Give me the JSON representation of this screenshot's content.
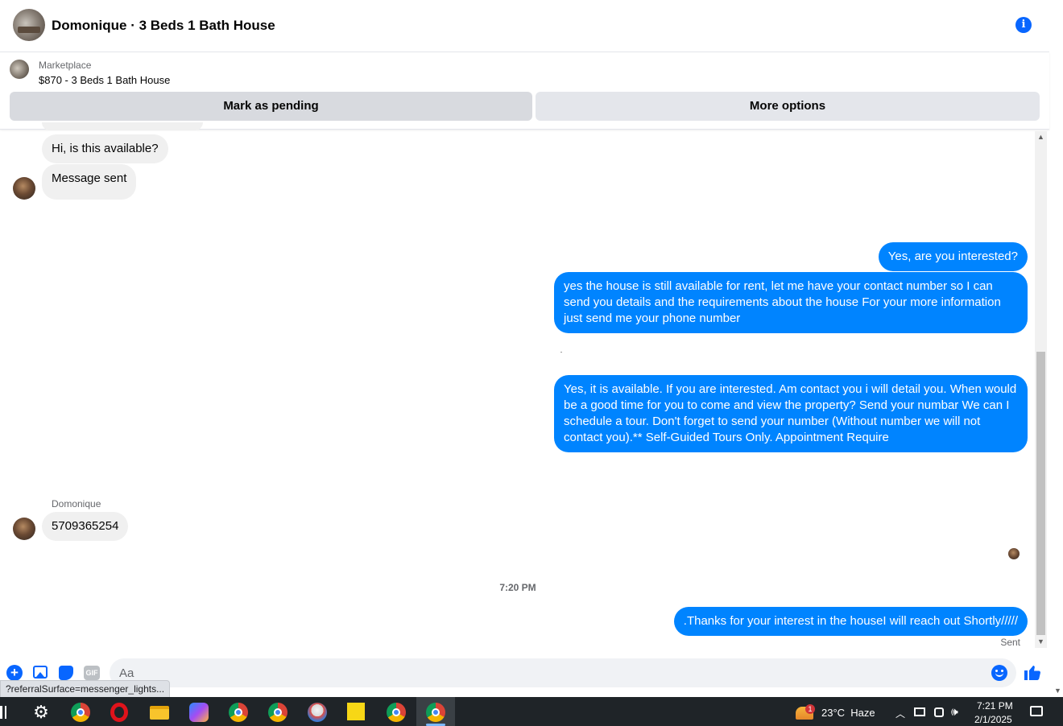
{
  "header": {
    "title": "Domonique · 3 Beds 1 Bath House"
  },
  "listing": {
    "source_label": "Marketplace",
    "item_text": "$870 - 3 Beds 1 Bath House",
    "pending_button": "Mark as pending",
    "more_button": "More options"
  },
  "messages": {
    "in_1": "Hi, is this available?",
    "in_2": "Message sent",
    "out_1": "Yes, are you interested?",
    "out_2": "yes the house is still available for rent, let me have your contact number so I can send you details and the requirements about the house For  your  more  information  just send  me   your  phone  number",
    "out_3": "Yes, it is available. If you are interested.  Am contact you i will detail you.  When would be a good time for you to come and view the property? Send your numbar We can I schedule a tour.  Don't forget to send your number (Without number we will not contact you).** Self-Guided Tours Only. Appointment Require",
    "sender_name": "Domonique",
    "in_3": "5709365254",
    "timestamp": "7:20 PM",
    "out_4": ".Thanks for your interest in the houseI will reach out Shortly/////",
    "status": "Sent"
  },
  "composer": {
    "placeholder": "Aa",
    "gif_label": "GIF"
  },
  "status_tooltip": "?referralSurface=messenger_lights...",
  "taskbar": {
    "notification_count": "1",
    "weather": "23°C  Haze",
    "time": "7:21 PM",
    "date": "2/1/2025"
  },
  "colors": {
    "accent": "#0866ff",
    "outgoing_bubble": "#0084ff",
    "incoming_bubble": "#f0f0f0",
    "taskbar": "#1f2428"
  }
}
